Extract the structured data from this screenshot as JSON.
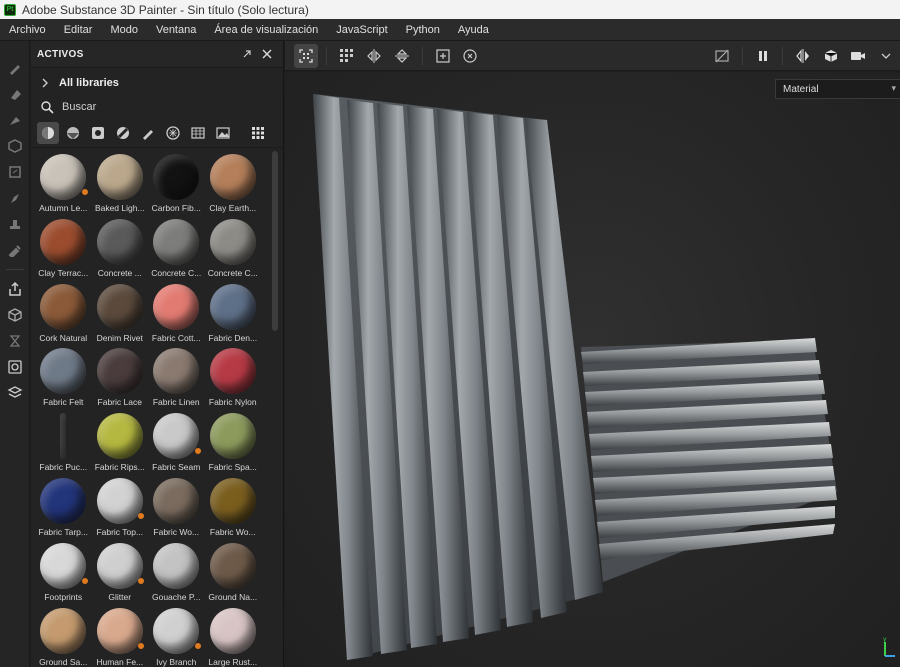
{
  "window": {
    "title": "Adobe Substance 3D Painter - Sin título (Solo lectura)",
    "logo_text": "Pt"
  },
  "menu": [
    "Archivo",
    "Editar",
    "Modo",
    "Ventana",
    "Área de visualización",
    "JavaScript",
    "Python",
    "Ayuda"
  ],
  "panel": {
    "title": "ACTIVOS",
    "libraries_label": "All libraries",
    "search_label": "Buscar",
    "filters": [
      "materials-filter",
      "smart-materials-filter",
      "masks-filter",
      "smart-masks-filter",
      "brushes-filter",
      "textures-filter",
      "environments-filter",
      "images-filter"
    ],
    "assets": [
      {
        "label": "Autumn Le...",
        "color": "#c9c2b8",
        "smart": true
      },
      {
        "label": "Baked Ligh...",
        "color": "#bba88c",
        "smart": false
      },
      {
        "label": "Carbon Fib...",
        "color": "#121212",
        "smart": false
      },
      {
        "label": "Clay Earth...",
        "color": "#b47f5a",
        "smart": false
      },
      {
        "label": "Clay Terrac...",
        "color": "#9b4c2e",
        "smart": false
      },
      {
        "label": "Concrete ...",
        "color": "#5a5a5a",
        "smart": false
      },
      {
        "label": "Concrete C...",
        "color": "#7d7d7b",
        "smart": false
      },
      {
        "label": "Concrete C...",
        "color": "#8d8b86",
        "smart": false
      },
      {
        "label": "Cork Natural",
        "color": "#8b5a38",
        "smart": false
      },
      {
        "label": "Denim Rivet",
        "color": "#5b4a3c",
        "smart": false
      },
      {
        "label": "Fabric Cott...",
        "color": "#e27b72",
        "smart": false
      },
      {
        "label": "Fabric Den...",
        "color": "#5e6f88",
        "smart": false
      },
      {
        "label": "Fabric Felt",
        "color": "#6f7a88",
        "smart": false
      },
      {
        "label": "Fabric Lace",
        "color": "#4a3c3c",
        "smart": false
      },
      {
        "label": "Fabric Linen",
        "color": "#8a7a70",
        "smart": false
      },
      {
        "label": "Fabric Nylon",
        "color": "#b63a45",
        "smart": false
      },
      {
        "label": "Fabric Puc...",
        "color": "#3a3a3a",
        "smart": false,
        "thin": true
      },
      {
        "label": "Fabric Rips...",
        "color": "#b5b840",
        "smart": false
      },
      {
        "label": "Fabric Seam",
        "color": "#c9c9c9",
        "smart": true
      },
      {
        "label": "Fabric Spa...",
        "color": "#8c9a5c",
        "smart": false
      },
      {
        "label": "Fabric Tarp...",
        "color": "#22347a",
        "smart": false
      },
      {
        "label": "Fabric Top...",
        "color": "#d2d2d2",
        "smart": true
      },
      {
        "label": "Fabric Wo...",
        "color": "#7a6b5e",
        "smart": false
      },
      {
        "label": "Fabric Wo...",
        "color": "#7a5e1e",
        "smart": false
      },
      {
        "label": "Footprints",
        "color": "#d8d8d8",
        "smart": true
      },
      {
        "label": "Glitter",
        "color": "#cfcfcf",
        "smart": true
      },
      {
        "label": "Gouache P...",
        "color": "#c3c3c3",
        "smart": false
      },
      {
        "label": "Ground Na...",
        "color": "#6e5a49",
        "smart": false
      },
      {
        "label": "Ground Sa...",
        "color": "#c49a6e",
        "smart": false
      },
      {
        "label": "Human Fe...",
        "color": "#d9a98d",
        "smart": true
      },
      {
        "label": "Ivy Branch",
        "color": "#d0d0d0",
        "smart": true
      },
      {
        "label": "Large Rust...",
        "color": "#d8c4c4",
        "smart": false
      }
    ]
  },
  "viewport": {
    "channel_label": "Material"
  },
  "colors": {
    "accent": "#e07a1f",
    "panel_bg": "#232323",
    "viewport_bg": "#262626"
  }
}
